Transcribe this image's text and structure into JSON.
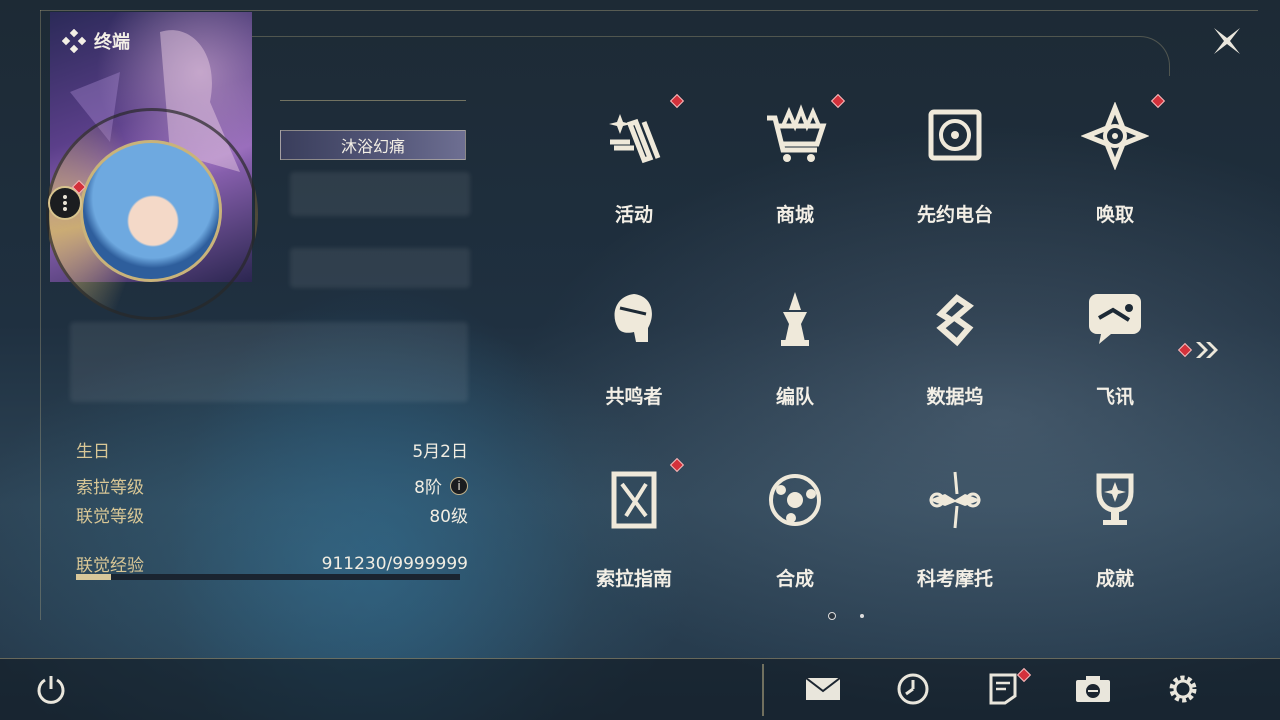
{
  "header": {
    "terminal_label": "终端"
  },
  "profile": {
    "title_badge": "沐浴幻痛",
    "info": [
      {
        "key": "生日",
        "value": "5月2日"
      },
      {
        "key": "索拉等级",
        "value": "8阶"
      },
      {
        "key": "联觉等级",
        "value": "80级"
      }
    ],
    "exp_label": "联觉经验",
    "exp_value": "911230/9999999",
    "exp_fraction": 0.091
  },
  "menu": [
    {
      "label": "活动",
      "icon": "activity-icon",
      "alert": true
    },
    {
      "label": "商城",
      "icon": "shop-cart-icon",
      "alert": true
    },
    {
      "label": "先约电台",
      "icon": "radio-icon",
      "alert": false
    },
    {
      "label": "唤取",
      "icon": "summon-compass-icon",
      "alert": true
    },
    {
      "label": "共鸣者",
      "icon": "resonator-head-icon",
      "alert": false
    },
    {
      "label": "编队",
      "icon": "chess-team-icon",
      "alert": false
    },
    {
      "label": "数据坞",
      "icon": "data-dock-icon",
      "alert": false
    },
    {
      "label": "飞讯",
      "icon": "message-bubble-icon",
      "alert": false
    },
    {
      "label": "索拉指南",
      "icon": "guide-book-icon",
      "alert": true
    },
    {
      "label": "合成",
      "icon": "synthesis-icon",
      "alert": false
    },
    {
      "label": "科考摩托",
      "icon": "motorbike-icon",
      "alert": false
    },
    {
      "label": "成就",
      "icon": "trophy-icon",
      "alert": false
    }
  ],
  "pager": {
    "current": 1,
    "total": 2
  },
  "bottom_bar": [
    "power-icon",
    "mail-icon",
    "clock-icon",
    "notice-icon",
    "camera-icon",
    "settings-gear-icon"
  ],
  "colors": {
    "accent": "#d8c79a",
    "alert": "#d3313b"
  }
}
